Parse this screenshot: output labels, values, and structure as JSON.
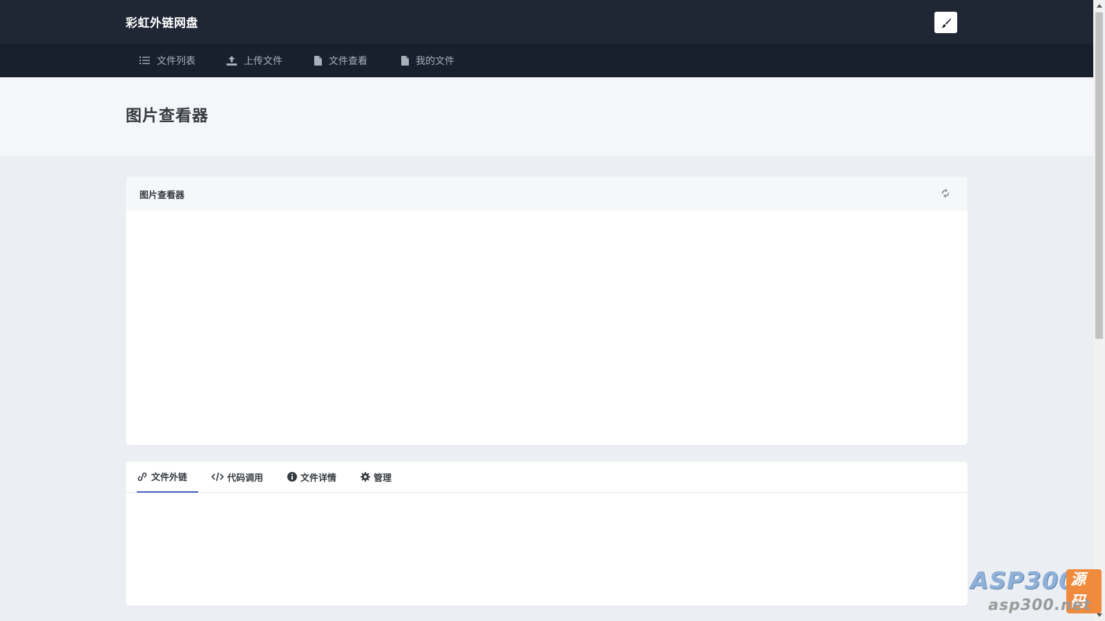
{
  "header": {
    "brand": "彩虹外链网盘",
    "theme_icon": "brush-icon"
  },
  "nav": {
    "items": [
      {
        "label": "文件列表",
        "icon": "list-icon"
      },
      {
        "label": "上传文件",
        "icon": "upload-icon"
      },
      {
        "label": "文件查看",
        "icon": "file-icon"
      },
      {
        "label": "我的文件",
        "icon": "file-icon"
      }
    ]
  },
  "page": {
    "title": "图片查看器"
  },
  "viewer_card": {
    "title": "图片查看器",
    "refresh_icon": "refresh-icon"
  },
  "tabs": [
    {
      "label": "文件外链",
      "icon": "link-icon",
      "active": true
    },
    {
      "label": "代码调用",
      "icon": "code-icon",
      "active": false
    },
    {
      "label": "文件详情",
      "icon": "info-icon",
      "active": false
    },
    {
      "label": "管理",
      "icon": "gear-icon",
      "active": false
    }
  ],
  "watermark": {
    "main": "ASP300",
    "badge": "源码",
    "url": "asp300.net"
  },
  "colors": {
    "topbar": "#1f2735",
    "navbar": "#18202d",
    "active_tab": "#3a5bbf",
    "background": "#ebeef2"
  }
}
